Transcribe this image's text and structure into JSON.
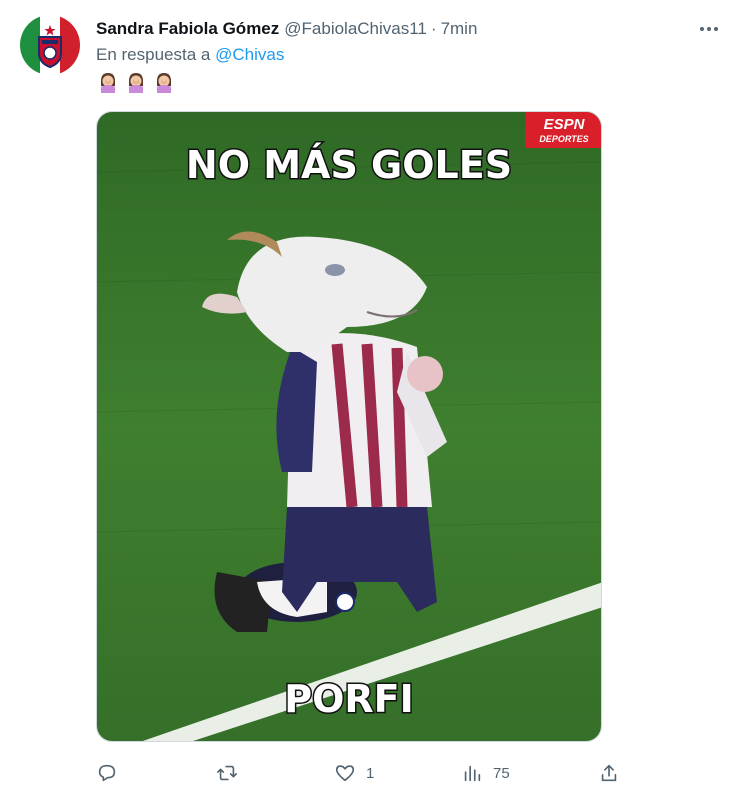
{
  "tweet": {
    "display_name": "Sandra Fabiola Gómez",
    "handle": "@FabiolaChivas11",
    "separator": "·",
    "time": "7min",
    "reply_prefix": "En respuesta a",
    "reply_to": "@Chivas",
    "emoji_count": 3
  },
  "media": {
    "caption_top": "NO MÁS GOLES",
    "caption_bottom": "PORFI",
    "watermark_top": "ESPN",
    "watermark_bottom": "DEPORTES"
  },
  "actions": {
    "reply_count": "",
    "retweet_count": "",
    "like_count": "1",
    "views_count": "75"
  },
  "colors": {
    "text_primary": "#0f1419",
    "text_secondary": "#536471",
    "link": "#1d9bf0",
    "field_green": "#3d7a2c",
    "espn_red": "#d9202a"
  },
  "icons": [
    "more-icon",
    "reply-icon",
    "retweet-icon",
    "like-icon",
    "views-icon",
    "share-icon"
  ]
}
